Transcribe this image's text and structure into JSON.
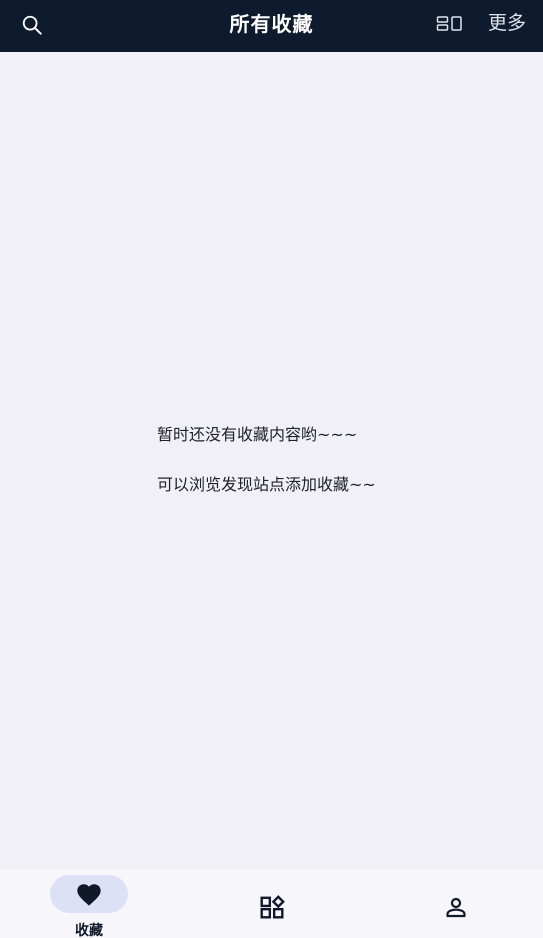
{
  "header": {
    "title": "所有收藏",
    "more_label": "更多",
    "search_icon": "search-icon",
    "layout_icon": "layout-toggle-icon"
  },
  "empty_state": {
    "line1": "暂时还没有收藏内容哟~~~",
    "line2": "可以浏览发现站点添加收藏~~"
  },
  "bottom_nav": {
    "items": [
      {
        "label": "收藏",
        "icon": "heart-icon",
        "active": true
      },
      {
        "label": "",
        "icon": "discover-grid-icon",
        "active": false
      },
      {
        "label": "",
        "icon": "person-icon",
        "active": false
      }
    ]
  },
  "colors": {
    "header_bg": "#0e1a2e",
    "page_bg": "#f1f0f7",
    "active_pill": "#dde1f6",
    "icon_dark": "#10182a"
  }
}
